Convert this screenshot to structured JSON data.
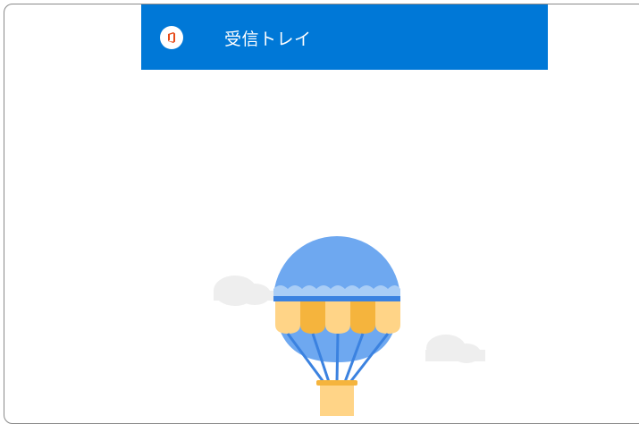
{
  "header": {
    "title": "受信トレイ",
    "background": "#0078d7",
    "logo_icon": "office-logo-icon"
  },
  "empty_state": {
    "illustration": "hot-air-balloon-illustration",
    "balloon_color": "#6ea8f0",
    "stripe_colors": [
      "#ffd487",
      "#f5b43d"
    ],
    "cloud_color": "#eeeeee"
  }
}
